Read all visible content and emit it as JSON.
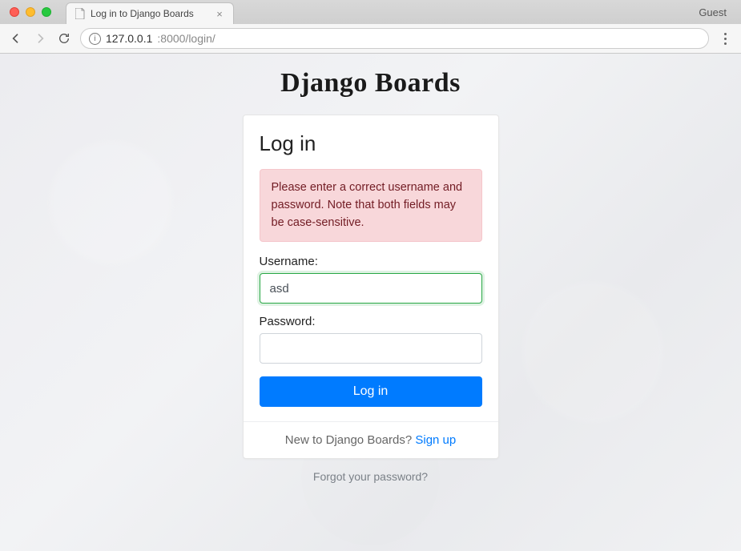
{
  "browser": {
    "tab_title": "Log in to Django Boards",
    "guest_label": "Guest",
    "url_host": "127.0.0.1",
    "url_port_path": ":8000/login/"
  },
  "page": {
    "brand": "Django Boards",
    "card_title": "Log in",
    "error_message": "Please enter a correct username and password. Note that both fields may be case-sensitive.",
    "username_label": "Username:",
    "username_value": "asd",
    "password_label": "Password:",
    "password_value": "",
    "submit_label": "Log in",
    "footer_text": "New to Django Boards? ",
    "signup_link": "Sign up",
    "forgot_link": "Forgot your password?"
  }
}
